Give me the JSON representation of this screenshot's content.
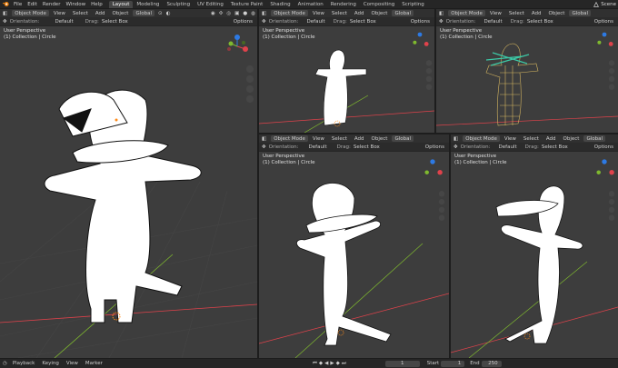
{
  "topbar": {
    "menus": [
      "File",
      "Edit",
      "Render",
      "Window",
      "Help"
    ],
    "workspaces": [
      "Layout",
      "Modeling",
      "Sculpting",
      "UV Editing",
      "Texture Paint",
      "Shading",
      "Animation",
      "Rendering",
      "Compositing",
      "Scripting"
    ],
    "active_workspace": "Layout",
    "scene": "Scene"
  },
  "viewport_header": {
    "mode": "Object Mode",
    "menus": [
      "View",
      "Select",
      "Add",
      "Object"
    ],
    "transform": "Global",
    "orientation_label": "Orientation:",
    "orientation_value": "Default",
    "drag_label": "Drag:",
    "drag_value": "Select Box",
    "options": "Options"
  },
  "viewports": {
    "main": {
      "line1": "User Perspective",
      "line2": "(1) Collection | Circle"
    },
    "top1": {
      "line1": "User Perspective",
      "line2": "(1) Collection | Circle"
    },
    "top2": {
      "line1": "User Perspective",
      "line2": "(1) Collection | Circle"
    },
    "bot1": {
      "line1": "User Perspective",
      "line2": "(1) Collection | Circle"
    },
    "bot2": {
      "line1": "User Perspective",
      "line2": "(1) Collection | Circle"
    }
  },
  "timeline": {
    "menus": [
      "Playback",
      "Keying",
      "View",
      "Marker"
    ],
    "current_frame": "1",
    "start_label": "Start",
    "start_value": "1",
    "end_label": "End",
    "end_value": "250"
  },
  "colors": {
    "x_axis": "#e0424b",
    "y_axis": "#7fb92f",
    "z_axis": "#2d7ae4",
    "wire": "#d4b560",
    "armature": "#3cc9a6"
  }
}
